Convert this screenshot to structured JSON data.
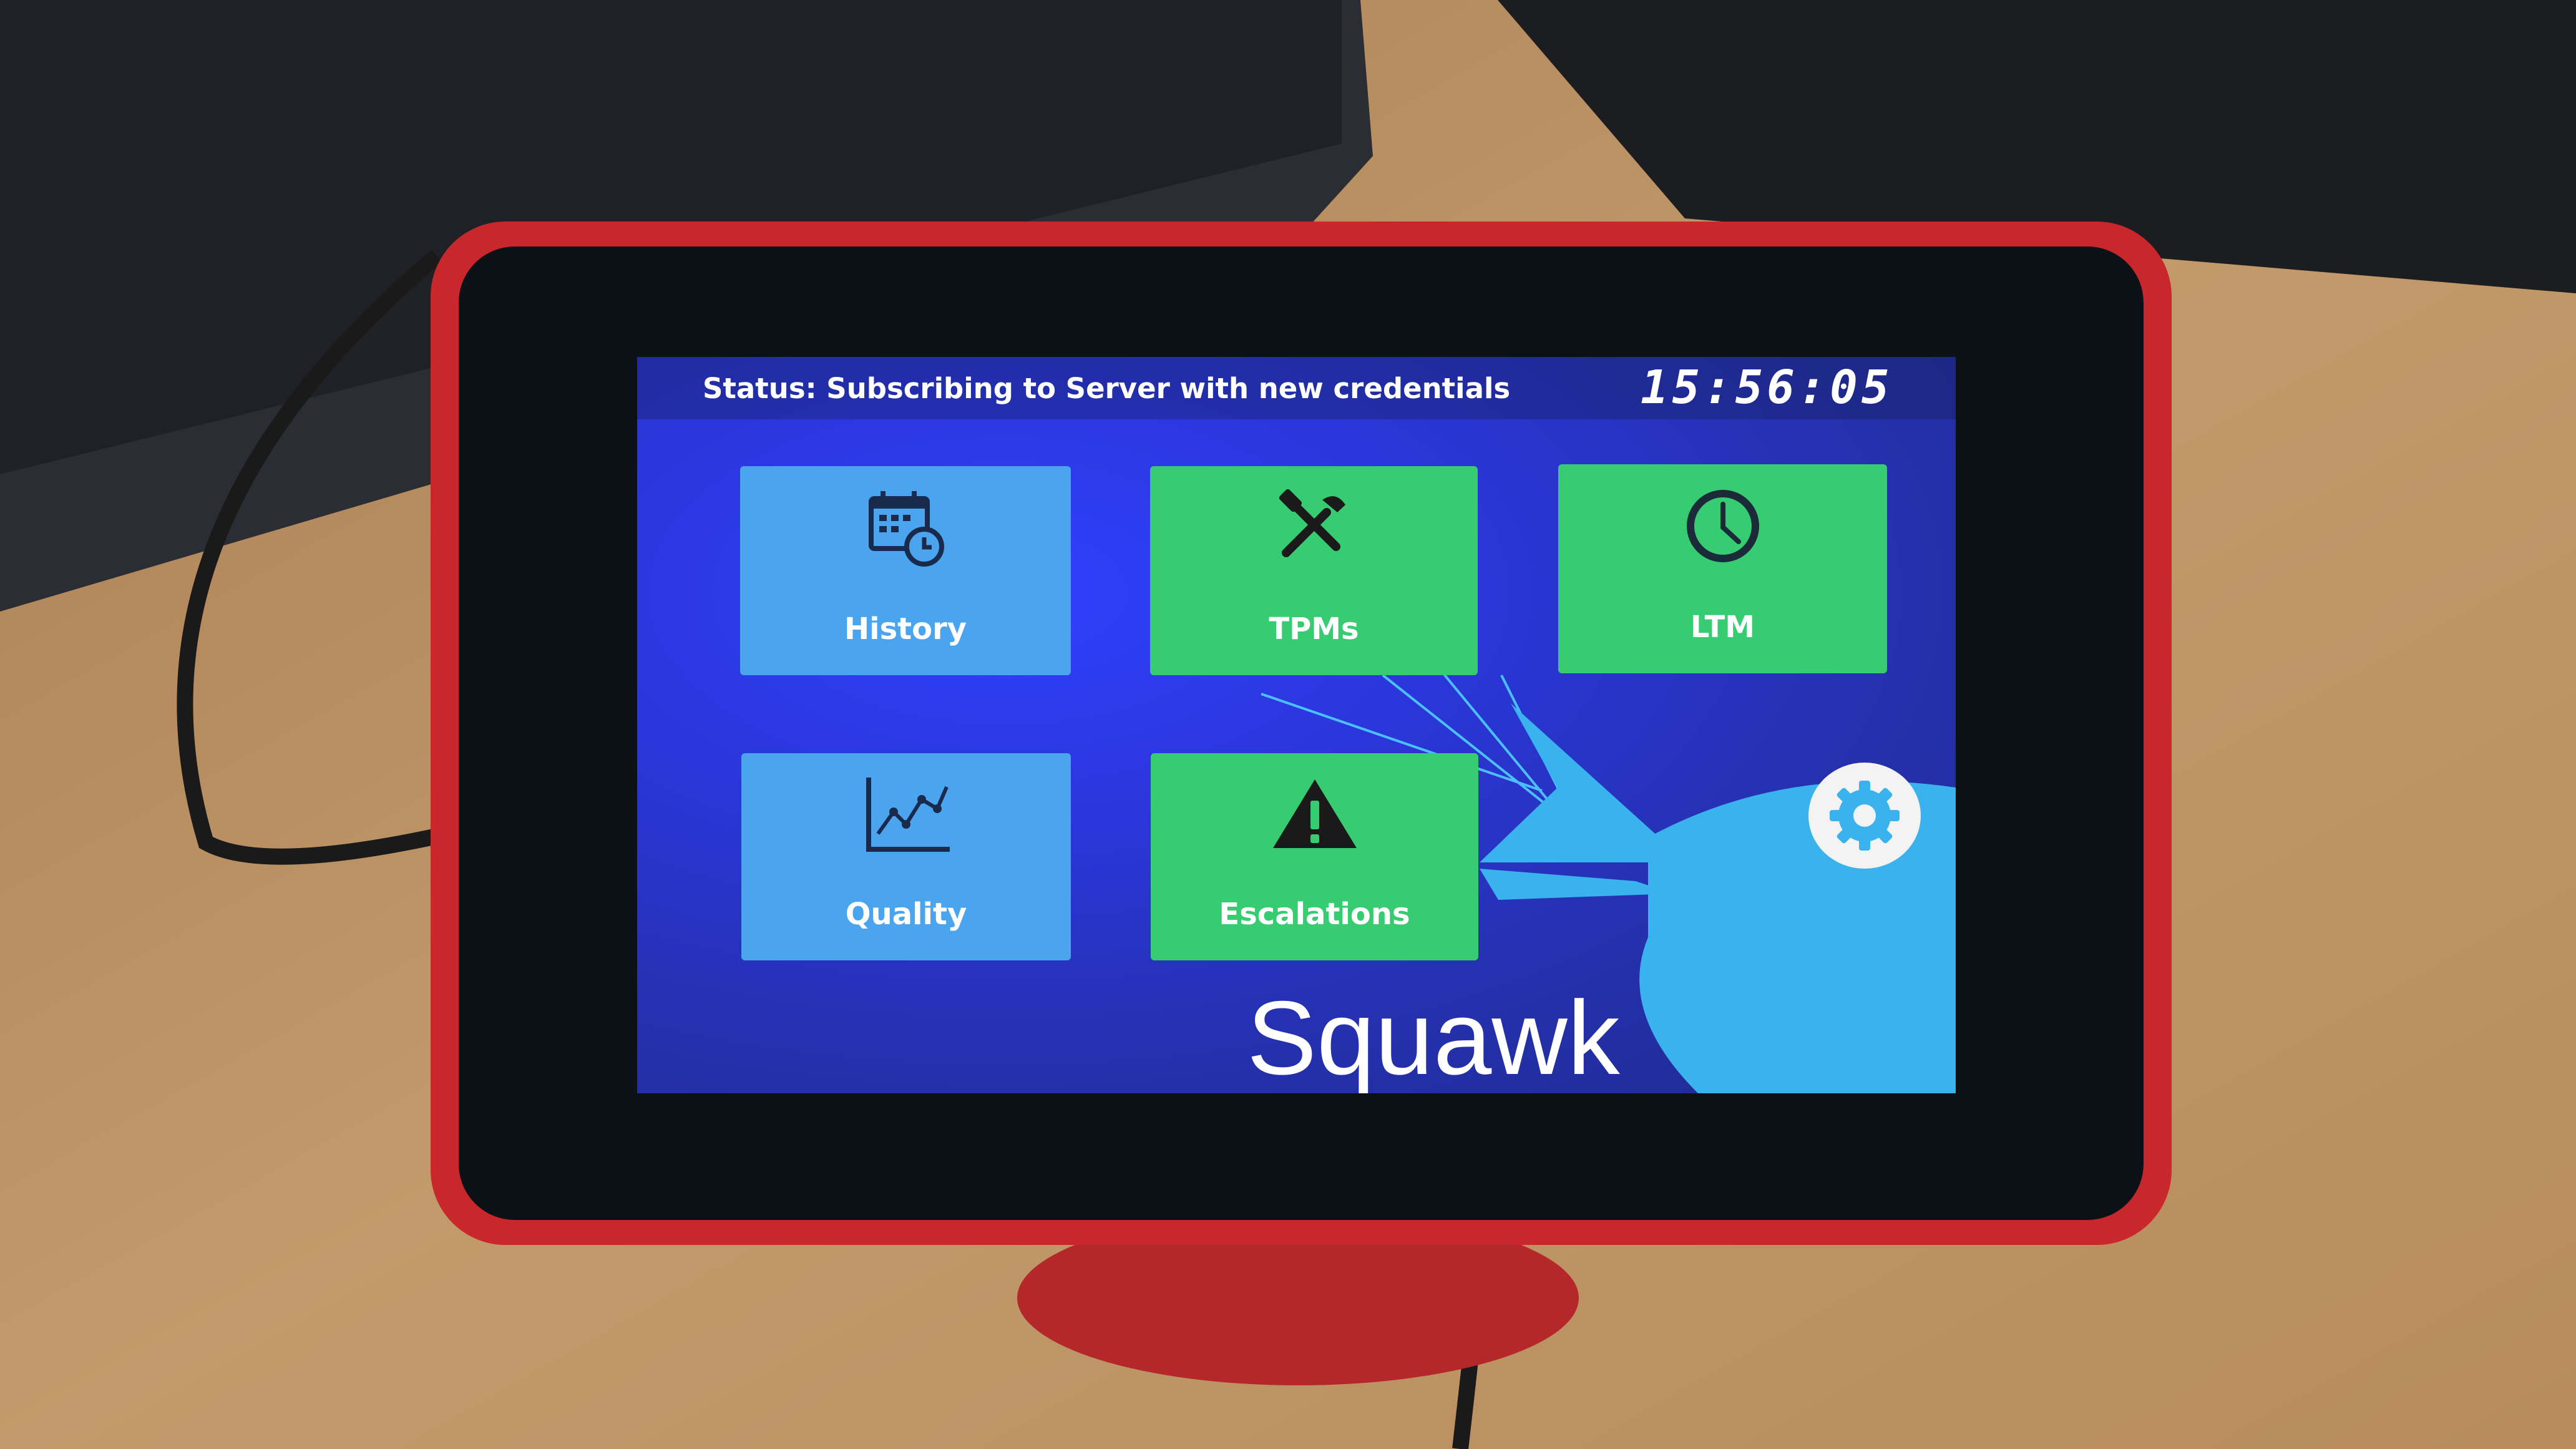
{
  "status_bar": {
    "status_text": "Status: Subscribing to Server with new credentials",
    "clock": "15:56:05"
  },
  "tiles": [
    {
      "label": "History",
      "icon": "calendar-clock-icon",
      "color": "#4aa4ee"
    },
    {
      "label": "TPMs",
      "icon": "tools-icon",
      "color": "#37cc72"
    },
    {
      "label": "LTM",
      "icon": "clock-icon",
      "color": "#37cc72"
    },
    {
      "label": "Quality",
      "icon": "line-chart-icon",
      "color": "#4aa4ee"
    },
    {
      "label": "Escalations",
      "icon": "warning-icon",
      "color": "#37cc72"
    }
  ],
  "brand": {
    "name": "Squawk"
  },
  "settings": {
    "icon": "gear-icon"
  },
  "colors": {
    "screen_background": "#2a36d8",
    "tile_blue": "#4aa4ee",
    "tile_green": "#37cc72",
    "bird": "#3ab2ee"
  }
}
